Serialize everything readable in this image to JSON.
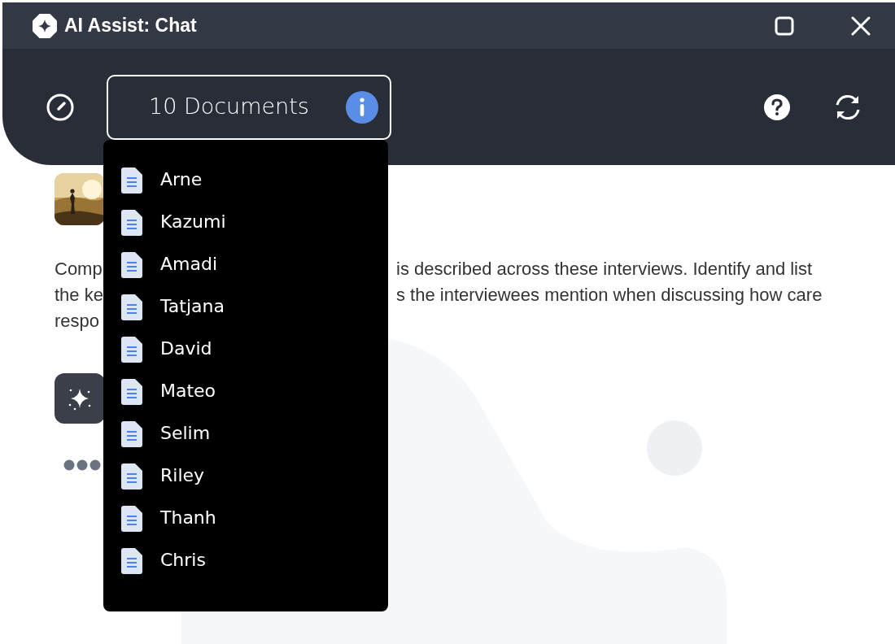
{
  "window": {
    "title": "AI Assist: Chat"
  },
  "toolbar": {
    "documents_button": {
      "label": "10 Documents"
    }
  },
  "documents_menu": {
    "items": [
      {
        "label": "Arne"
      },
      {
        "label": "Kazumi"
      },
      {
        "label": "Amadi"
      },
      {
        "label": "Tatjana"
      },
      {
        "label": "David"
      },
      {
        "label": "Mateo"
      },
      {
        "label": "Selim"
      },
      {
        "label": "Riley"
      },
      {
        "label": "Thanh"
      },
      {
        "label": "Chris"
      }
    ]
  },
  "messages": [
    {
      "kind": "user",
      "lines": [
        {
          "left": "Comp",
          "right": "is described across these interviews. Identify and list"
        },
        {
          "left": "the ke",
          "right": "s the interviewees mention when discussing how care"
        },
        {
          "left": "respo"
        }
      ]
    },
    {
      "kind": "assistant",
      "typing": true
    }
  ]
}
